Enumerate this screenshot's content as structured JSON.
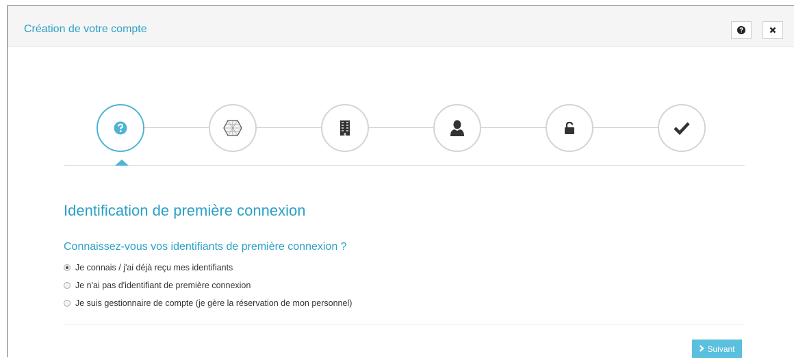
{
  "header": {
    "title": "Création de votre compte",
    "help_icon": "question-circle-icon",
    "close_icon": "close-icon"
  },
  "stepper": {
    "active_index": 0,
    "steps": [
      {
        "icon": "question-circle-icon"
      },
      {
        "icon": "hexagon-grid-icon"
      },
      {
        "icon": "building-icon"
      },
      {
        "icon": "user-icon"
      },
      {
        "icon": "unlock-icon"
      },
      {
        "icon": "check-icon"
      }
    ]
  },
  "main": {
    "section_title": "Identification de première connexion",
    "question": "Connaissez-vous vos identifiants de première connexion ?",
    "options": [
      {
        "label": "Je connais / j'ai déjà reçu mes identifiants",
        "checked": true
      },
      {
        "label": "Je n'ai pas d'identifiant de première connexion",
        "checked": false
      },
      {
        "label": "Je suis gestionnaire de compte (je gère la réservation de mon personnel)",
        "checked": false
      }
    ]
  },
  "footer": {
    "next_label": "Suivant",
    "next_icon": "chevron-right-icon"
  },
  "colors": {
    "accent": "#2aa0c5",
    "button": "#5bc0de",
    "active_step_border": "#4fb4d2"
  }
}
